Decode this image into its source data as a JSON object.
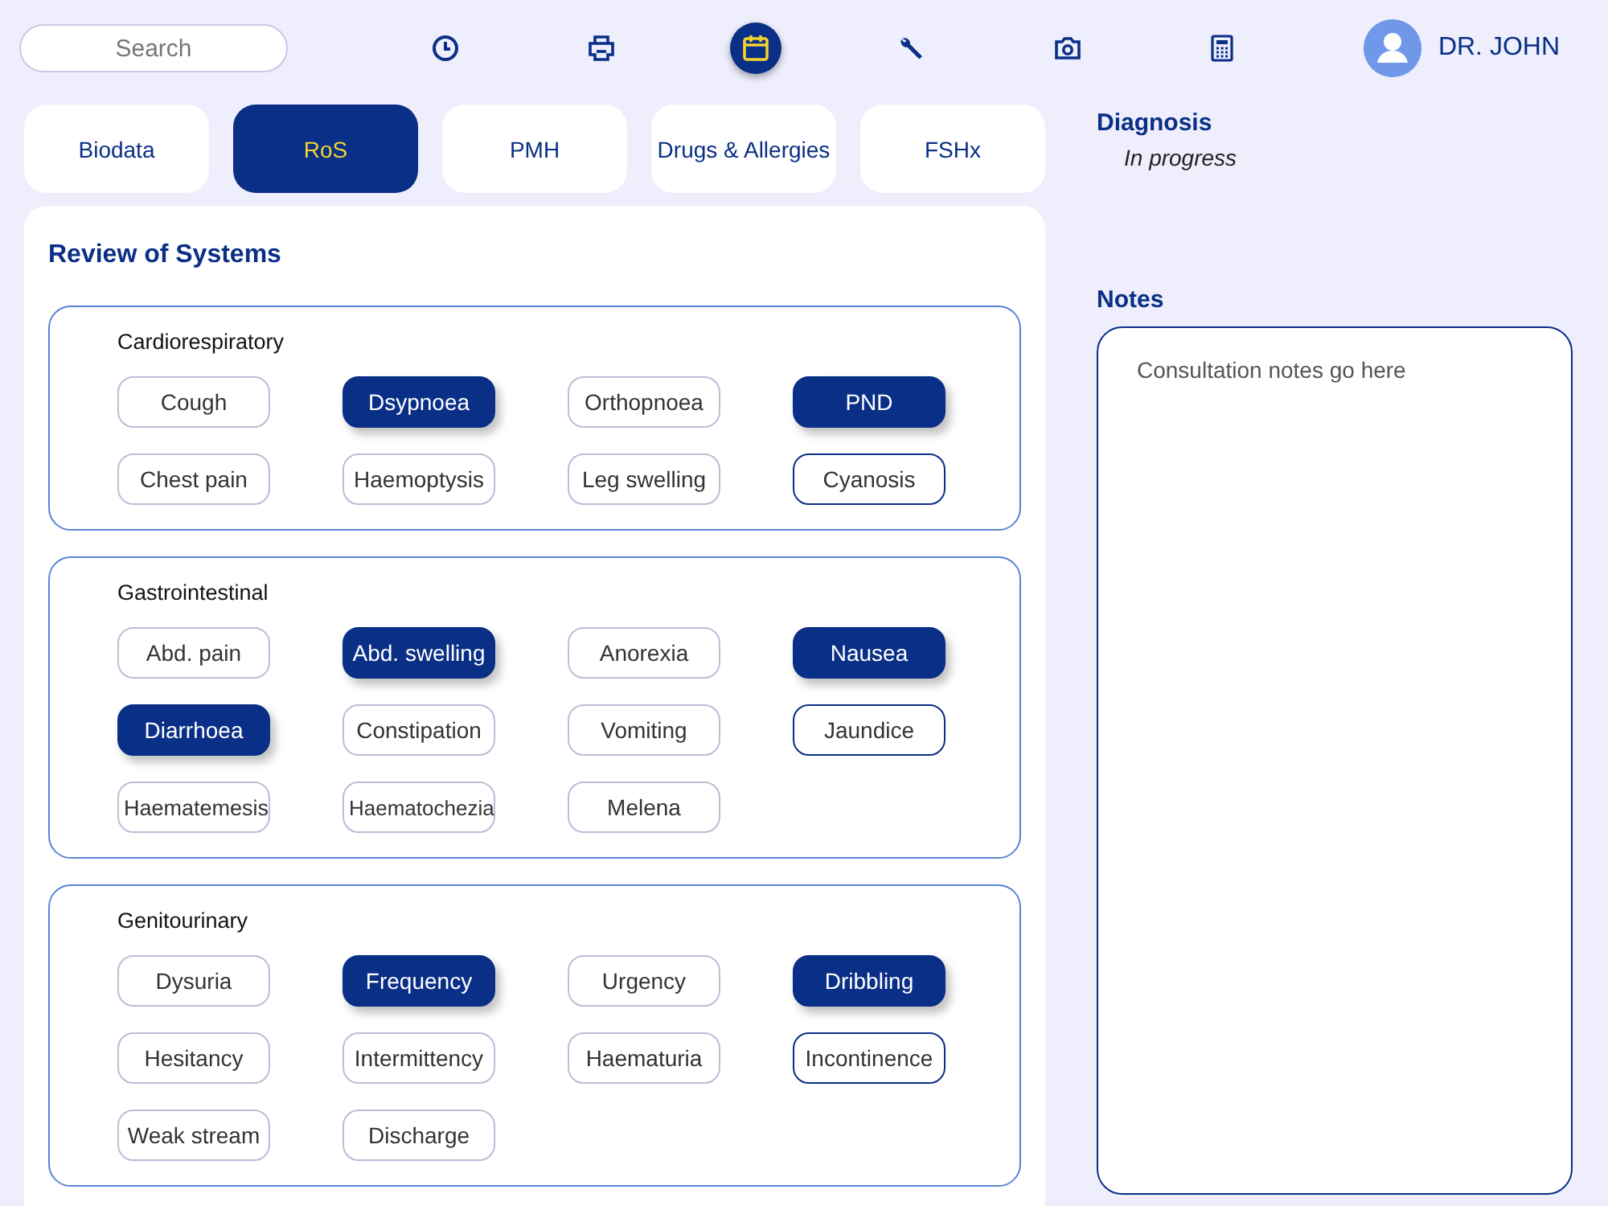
{
  "toolbar": {
    "search": {
      "placeholder": "Search"
    },
    "tools": [
      {
        "kind": "clock",
        "selected": false
      },
      {
        "kind": "printer",
        "selected": false
      },
      {
        "kind": "calendar",
        "selected": true
      },
      {
        "kind": "wrench",
        "selected": false
      },
      {
        "kind": "camera",
        "selected": false
      },
      {
        "kind": "calculator",
        "selected": false
      }
    ],
    "user": {
      "name": "DR. JOHN"
    }
  },
  "tabs": [
    {
      "label": "Biodata",
      "selected": false
    },
    {
      "label": "RoS",
      "selected": true
    },
    {
      "label": "PMH",
      "selected": false
    },
    {
      "label": "Drugs & Allergies",
      "selected": false
    },
    {
      "label": "FSHx",
      "selected": false
    }
  ],
  "review": {
    "title": "Review of Systems",
    "sections": [
      {
        "title": "Cardiorespiratory",
        "symptoms": [
          {
            "label": "Cough",
            "selected": false,
            "focused": false
          },
          {
            "label": "Dsypnoea",
            "selected": true,
            "focused": false
          },
          {
            "label": "Orthopnoea",
            "selected": false,
            "focused": false
          },
          {
            "label": "PND",
            "selected": true,
            "focused": false
          },
          {
            "label": "Chest pain",
            "selected": false,
            "focused": false
          },
          {
            "label": "Haemoptysis",
            "selected": false,
            "focused": false
          },
          {
            "label": "Leg swelling",
            "selected": false,
            "focused": false
          },
          {
            "label": "Cyanosis",
            "selected": false,
            "focused": true
          }
        ]
      },
      {
        "title": "Gastrointestinal",
        "symptoms": [
          {
            "label": "Abd. pain",
            "selected": false,
            "focused": false
          },
          {
            "label": "Abd. swelling",
            "selected": true,
            "focused": false
          },
          {
            "label": "Anorexia",
            "selected": false,
            "focused": false
          },
          {
            "label": "Nausea",
            "selected": true,
            "focused": false
          },
          {
            "label": "Diarrhoea",
            "selected": true,
            "focused": false
          },
          {
            "label": "Constipation",
            "selected": false,
            "focused": false
          },
          {
            "label": "Vomiting",
            "selected": false,
            "focused": false
          },
          {
            "label": "Jaundice",
            "selected": false,
            "focused": true
          },
          {
            "label": "Haematemesis",
            "selected": false,
            "focused": false
          },
          {
            "label": "Haematochezia",
            "selected": false,
            "focused": false
          },
          {
            "label": "Melena",
            "selected": false,
            "focused": false
          }
        ]
      },
      {
        "title": "Genitourinary",
        "symptoms": [
          {
            "label": "Dysuria",
            "selected": false,
            "focused": false
          },
          {
            "label": "Frequency",
            "selected": true,
            "focused": false
          },
          {
            "label": "Urgency",
            "selected": false,
            "focused": false
          },
          {
            "label": "Dribbling",
            "selected": true,
            "focused": false
          },
          {
            "label": "Hesitancy",
            "selected": false,
            "focused": false
          },
          {
            "label": "Intermittency",
            "selected": false,
            "focused": false
          },
          {
            "label": "Haematuria",
            "selected": false,
            "focused": false
          },
          {
            "label": "Incontinence",
            "selected": false,
            "focused": true
          },
          {
            "label": "Weak stream",
            "selected": false,
            "focused": false
          },
          {
            "label": "Discharge",
            "selected": false,
            "focused": false
          }
        ]
      }
    ]
  },
  "diagnosis": {
    "heading": "Diagnosis",
    "status": "In progress"
  },
  "notes": {
    "heading": "Notes",
    "placeholder": "Consultation notes go here"
  }
}
